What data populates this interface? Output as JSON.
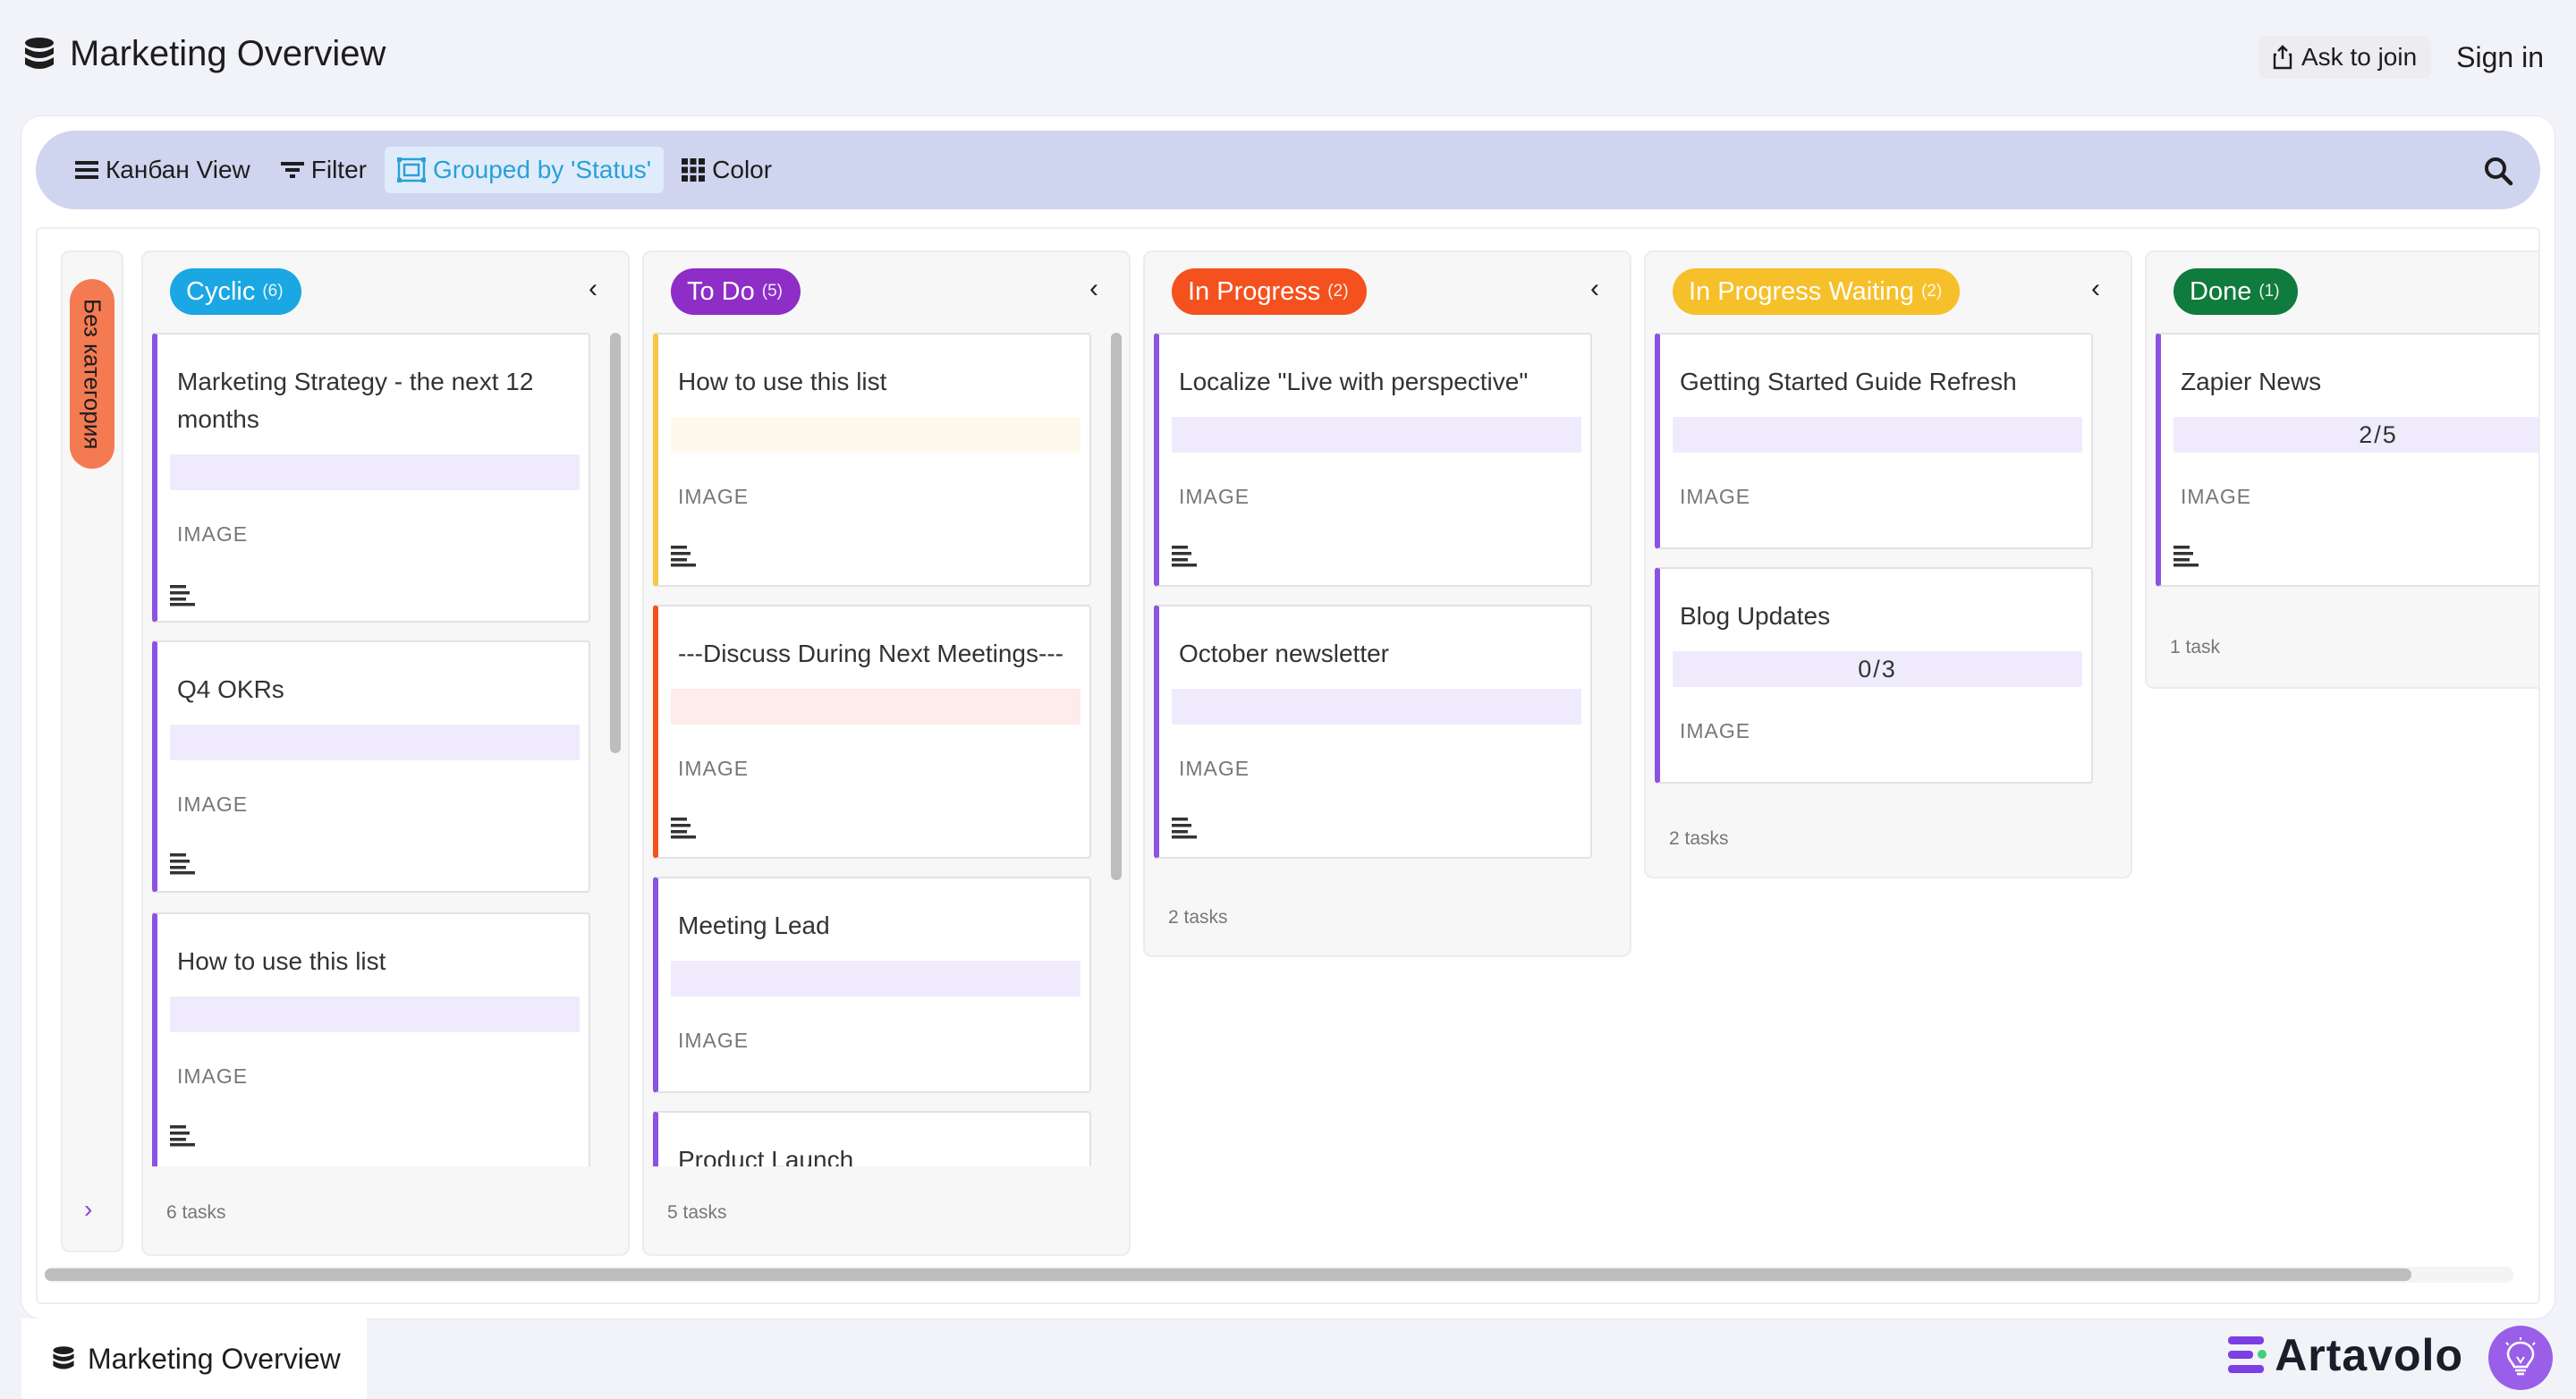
{
  "header": {
    "title": "Marketing Overview",
    "ask_to_join": "Ask to join",
    "sign_in": "Sign in"
  },
  "toolbar": {
    "view_label": "Канбан View",
    "filter_label": "Filter",
    "grouped_label": "Grouped by 'Status'",
    "color_label": "Color"
  },
  "rail": {
    "label": "Без категория"
  },
  "columns": [
    {
      "name": "Cyclic",
      "count": "(6)",
      "color": "#1ba7e3",
      "footer": "6 tasks",
      "cards": [
        {
          "title": "Marketing Strategy - the next 12 months",
          "bar": "",
          "image": "IMAGE"
        },
        {
          "title": "Q4 OKRs",
          "bar": "",
          "image": "IMAGE"
        },
        {
          "title": "How to use this list",
          "bar": "",
          "image": "IMAGE"
        }
      ]
    },
    {
      "name": "To Do",
      "count": "(5)",
      "color": "#8e2ec6",
      "footer": "5 tasks",
      "cards": [
        {
          "title": "How to use this list",
          "bar": "",
          "image": "IMAGE"
        },
        {
          "title": "---Discuss During Next Meetings---",
          "bar": "",
          "image": "IMAGE"
        },
        {
          "title": "Meeting Lead",
          "bar": "",
          "image": "IMAGE"
        },
        {
          "title": "Product Launch",
          "bar": "",
          "image": ""
        }
      ]
    },
    {
      "name": "In Progress",
      "count": "(2)",
      "color": "#f4511e",
      "footer": "2 tasks",
      "cards": [
        {
          "title": "Localize \"Live with perspective\"",
          "bar": "",
          "image": "IMAGE"
        },
        {
          "title": "October newsletter",
          "bar": "",
          "image": "IMAGE"
        }
      ]
    },
    {
      "name": "In Progress Waiting",
      "count": "(2)",
      "color": "#f6c02b",
      "footer": "2 tasks",
      "cards": [
        {
          "title": "Getting Started Guide Refresh",
          "bar": "",
          "image": "IMAGE"
        },
        {
          "title": "Blog Updates",
          "bar": "0/3",
          "image": "IMAGE"
        }
      ]
    },
    {
      "name": "Done",
      "count": "(1)",
      "color": "#0f7b3c",
      "footer": "1 task",
      "cards": [
        {
          "title": "Zapier News",
          "bar": "2/5",
          "image": "IMAGE"
        }
      ]
    }
  ],
  "footer": {
    "tab_title": "Marketing Overview",
    "brand": "Artavolo"
  },
  "icons": {
    "database": "database-icon",
    "share": "share-icon",
    "menu": "menu-icon",
    "filter": "filter-icon",
    "group": "group-icon",
    "grid": "grid-icon",
    "search": "search-icon",
    "lines": "text-lines-icon",
    "bulb": "lightbulb-icon"
  }
}
